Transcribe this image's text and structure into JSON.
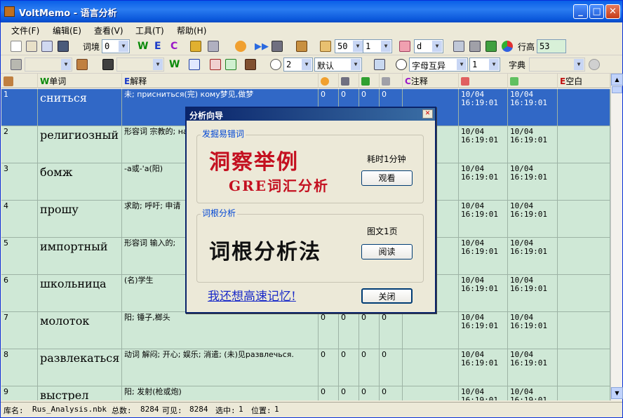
{
  "window": {
    "title": "VoltMemo - 语言分析"
  },
  "menu": [
    "文件(F)",
    "编辑(E)",
    "查看(V)",
    "工具(T)",
    "帮助(H)"
  ],
  "toolbar1": {
    "context_label": "词境",
    "context_value": "0",
    "font_size": "50",
    "font_count": "1",
    "sort_letter": "d",
    "row_height_label": "行高",
    "row_height_value": "53"
  },
  "toolbar2": {
    "timer_value": "2",
    "mode_value": "默认",
    "compare_value": "字母互异",
    "compare_count": "1",
    "dict_label": "字典"
  },
  "columns": [
    "",
    "单词",
    "解释",
    "",
    "",
    "",
    "",
    "注释",
    "",
    "",
    "空白"
  ],
  "rows": [
    {
      "idx": "1",
      "word": "сниться",
      "def": "未; присниться(完) кому梦见,做梦",
      "n1": "0",
      "n2": "0",
      "n3": "0",
      "n4": "0",
      "d1a": "10/04",
      "d1b": "16:19:01",
      "d2a": "10/04",
      "d2b": "16:19:01"
    },
    {
      "idx": "2",
      "word": "религиозный",
      "def": "形容词 宗教的; на (形): (1)(只用全)宗教的",
      "n1": "0",
      "n2": "0",
      "n3": "0",
      "n4": "0",
      "d1a": "10/04",
      "d1b": "16:19:01",
      "d2a": "10/04",
      "d2b": "16:19:01"
    },
    {
      "idx": "3",
      "word": "бомж",
      "def": "-а或-'а(阳)",
      "n1": "0",
      "n2": "0",
      "n3": "0",
      "n4": "0",
      "d1a": "10/04",
      "d1b": "16:19:01",
      "d2a": "10/04",
      "d2b": "16:19:01"
    },
    {
      "idx": "4",
      "word": "прошу",
      "def": "求助; 呼吁; 申请",
      "n1": "0",
      "n2": "0",
      "n3": "0",
      "n4": "0",
      "d1a": "10/04",
      "d1b": "16:19:01",
      "d2a": "10/04",
      "d2b": "16:19:01"
    },
    {
      "idx": "5",
      "word": "импортный",
      "def": "形容词 输入的;",
      "n1": "0",
      "n2": "0",
      "n3": "0",
      "n4": "0",
      "d1a": "10/04",
      "d1b": "16:19:01",
      "d2a": "10/04",
      "d2b": "16:19:01"
    },
    {
      "idx": "6",
      "word": "школьница",
      "def": "(名)学生",
      "n1": "0",
      "n2": "0",
      "n3": "0",
      "n4": "0",
      "d1a": "10/04",
      "d1b": "16:19:01",
      "d2a": "10/04",
      "d2b": "16:19:01"
    },
    {
      "idx": "7",
      "word": "молоток",
      "def": "阳; 锤子,榔头",
      "n1": "0",
      "n2": "0",
      "n3": "0",
      "n4": "0",
      "d1a": "10/04",
      "d1b": "16:19:01",
      "d2a": "10/04",
      "d2b": "16:19:01"
    },
    {
      "idx": "8",
      "word": "развлекаться",
      "def": "动词 解闷; 开心; 娱乐; 消遣; (未)见развлечься.",
      "n1": "0",
      "n2": "0",
      "n3": "0",
      "n4": "0",
      "d1a": "10/04",
      "d1b": "16:19:01",
      "d2a": "10/04",
      "d2b": "16:19:01"
    },
    {
      "idx": "9",
      "word": "выстрел",
      "def": "阳; 发射(枪或炮)",
      "n1": "0",
      "n2": "0",
      "n3": "0",
      "n4": "0",
      "d1a": "10/04",
      "d1b": "16:19:01",
      "d2a": "10/04",
      "d2b": "16:19:01"
    }
  ],
  "status": {
    "library_label": "库名:",
    "library_value": "Rus_Analysis.nbk",
    "total_label": "总数:",
    "total_value": "8284",
    "visible_label": "可见:",
    "visible_value": "8284",
    "selected_label": "选中:",
    "selected_value": "1",
    "position_label": "位置:",
    "position_value": "1"
  },
  "dialog": {
    "title": "分析向导",
    "group1_label": "发掘易错词",
    "logo1_line1": "洞察举例",
    "logo1_line2": "GRE词汇分析",
    "info1": "耗时1分钟",
    "btn1": "观看",
    "group2_label": "词根分析",
    "logo2": "词根分析法",
    "info2": "图文1页",
    "btn2": "阅读",
    "link": "我还想高速记忆!",
    "close_btn": "关闭"
  }
}
